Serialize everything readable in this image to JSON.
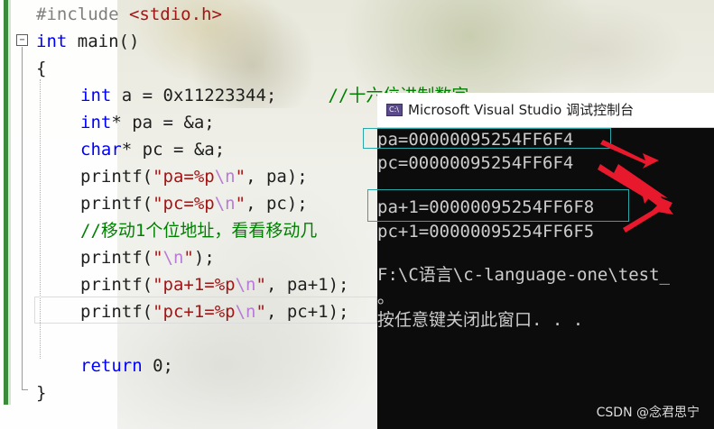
{
  "editor": {
    "lines": [
      {
        "segments": [
          {
            "t": "#include ",
            "c": "pp"
          },
          {
            "t": "<stdio.h>",
            "c": "inc"
          }
        ]
      },
      {
        "segments": [
          {
            "t": "int",
            "c": "kw"
          },
          {
            "t": " main()",
            "c": "tx"
          }
        ]
      },
      {
        "segments": [
          {
            "t": "{",
            "c": "tx"
          }
        ]
      },
      {
        "segments": [
          {
            "t": "int",
            "c": "kw"
          },
          {
            "t": " a = 0x11223344;     ",
            "c": "tx"
          },
          {
            "t": "//十六位进制数字",
            "c": "cmt"
          }
        ]
      },
      {
        "segments": [
          {
            "t": "int",
            "c": "kw"
          },
          {
            "t": "* pa = &a;",
            "c": "tx"
          }
        ]
      },
      {
        "segments": [
          {
            "t": "char",
            "c": "kw"
          },
          {
            "t": "* pc = &a;",
            "c": "tx"
          }
        ]
      },
      {
        "segments": [
          {
            "t": "printf(",
            "c": "tx"
          },
          {
            "t": "\"pa=%p",
            "c": "str"
          },
          {
            "t": "\\n",
            "c": "esc"
          },
          {
            "t": "\"",
            "c": "str"
          },
          {
            "t": ", pa);",
            "c": "tx"
          }
        ]
      },
      {
        "segments": [
          {
            "t": "printf(",
            "c": "tx"
          },
          {
            "t": "\"pc=%p",
            "c": "str"
          },
          {
            "t": "\\n",
            "c": "esc"
          },
          {
            "t": "\"",
            "c": "str"
          },
          {
            "t": ", pc);",
            "c": "tx"
          }
        ]
      },
      {
        "segments": [
          {
            "t": "//移动1个位地址，看看移动几",
            "c": "cmt"
          }
        ]
      },
      {
        "segments": [
          {
            "t": "printf(",
            "c": "tx"
          },
          {
            "t": "\"",
            "c": "str"
          },
          {
            "t": "\\n",
            "c": "esc"
          },
          {
            "t": "\"",
            "c": "str"
          },
          {
            "t": ");",
            "c": "tx"
          }
        ]
      },
      {
        "segments": [
          {
            "t": "printf(",
            "c": "tx"
          },
          {
            "t": "\"pa+1=%p",
            "c": "str"
          },
          {
            "t": "\\n",
            "c": "esc"
          },
          {
            "t": "\"",
            "c": "str"
          },
          {
            "t": ", pa+1);",
            "c": "tx"
          }
        ]
      },
      {
        "segments": [
          {
            "t": "printf(",
            "c": "tx"
          },
          {
            "t": "\"pc+1=%p",
            "c": "str"
          },
          {
            "t": "\\n",
            "c": "esc"
          },
          {
            "t": "\"",
            "c": "str"
          },
          {
            "t": ", pc+1);",
            "c": "tx"
          }
        ]
      },
      {
        "segments": []
      },
      {
        "segments": [
          {
            "t": "return",
            "c": "kw"
          },
          {
            "t": " 0;",
            "c": "tx"
          }
        ]
      },
      {
        "segments": [
          {
            "t": "}",
            "c": "tx"
          }
        ]
      }
    ],
    "fold_icon": "minus"
  },
  "console": {
    "title": "Microsoft Visual Studio 调试控制台",
    "icon": "visual-studio-console-icon",
    "output": [
      "pa=00000095254FF6F4",
      "pc=00000095254FF6F4",
      "",
      "pa+1=00000095254FF6F8",
      "pc+1=00000095254FF6F5",
      "",
      "F:\\C语言\\c-language-one\\test_",
      "。",
      "按任意键关闭此窗口. . ."
    ]
  },
  "watermark": "CSDN @念君思宁",
  "colors": {
    "keyword": "#0000ff",
    "string": "#a31515",
    "comment": "#008000",
    "arrow": "#e8192c",
    "highlight": "#2aa7a7"
  }
}
